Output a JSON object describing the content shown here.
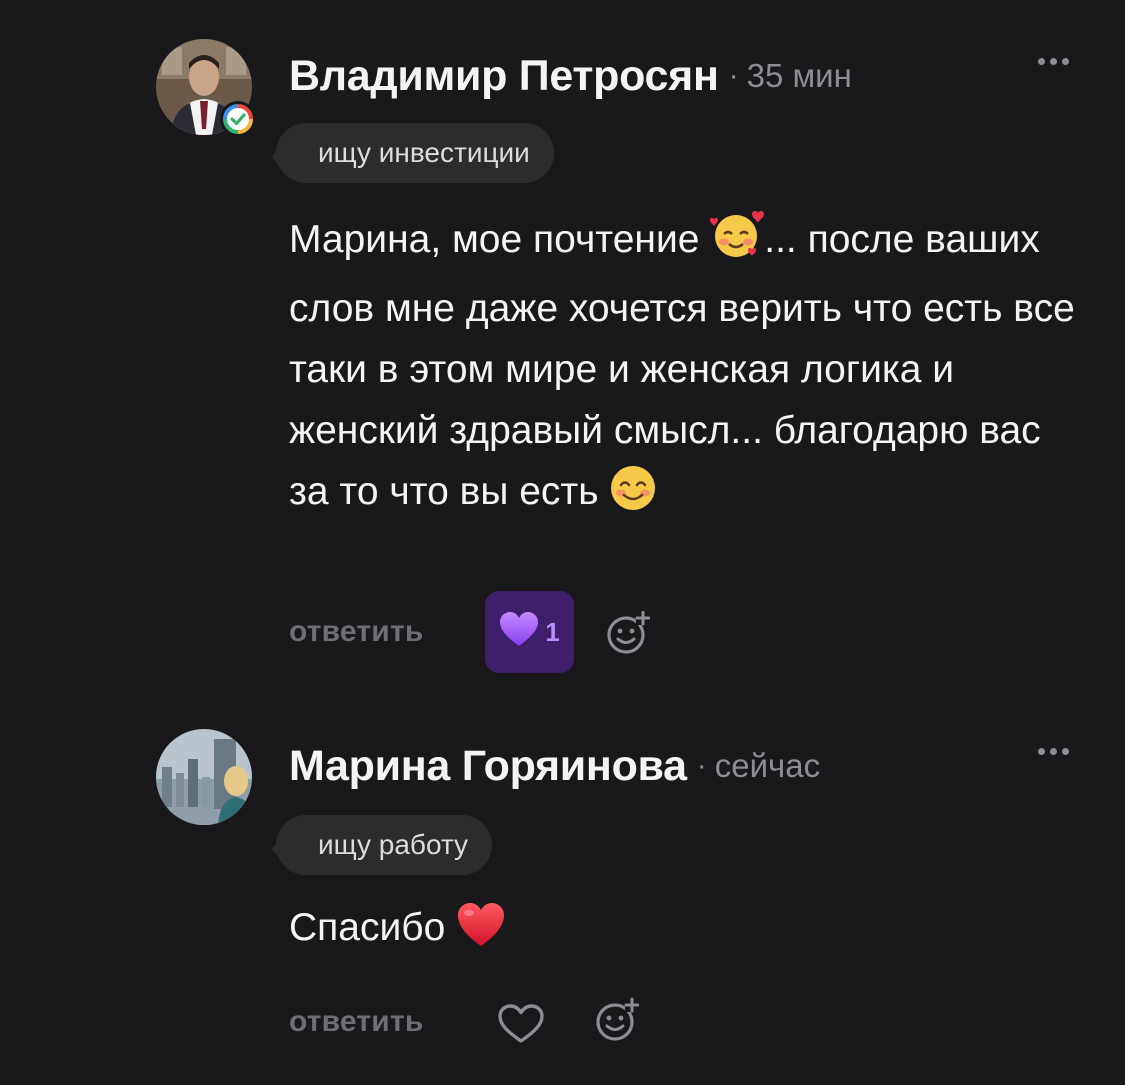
{
  "comments": [
    {
      "author": "Владимир Петросян",
      "separator": "·",
      "time": "35 мин",
      "tag": "ищу инвестиции",
      "text_part1": "Марина, мое почтение ",
      "text_part2": "... после ваших слов мне даже хочется верить что есть все таки в этом мире и женская логика и женский здравый смысл... благодарю вас за то что вы есть ",
      "reply_label": "ответить",
      "like_count": "1",
      "liked": true,
      "verified": true
    },
    {
      "author": "Марина Горяинова",
      "separator": "·",
      "time": "сейчас",
      "tag": "ищу работу",
      "text": "Спасибо ",
      "reply_label": "ответить",
      "liked": false
    }
  ],
  "colors": {
    "background": "#19191b",
    "muted": "#8d8d92",
    "tag_bg": "#2c2c2e",
    "like_active_bg": "#3d1f6b",
    "like_active_accent": "#a855f7"
  },
  "icons": [
    "more-icon",
    "heart-icon",
    "purple-heart-icon",
    "add-reaction-icon",
    "verified-icon",
    "smiling-face-with-hearts-emoji",
    "smiling-face-emoji",
    "red-heart-emoji"
  ]
}
